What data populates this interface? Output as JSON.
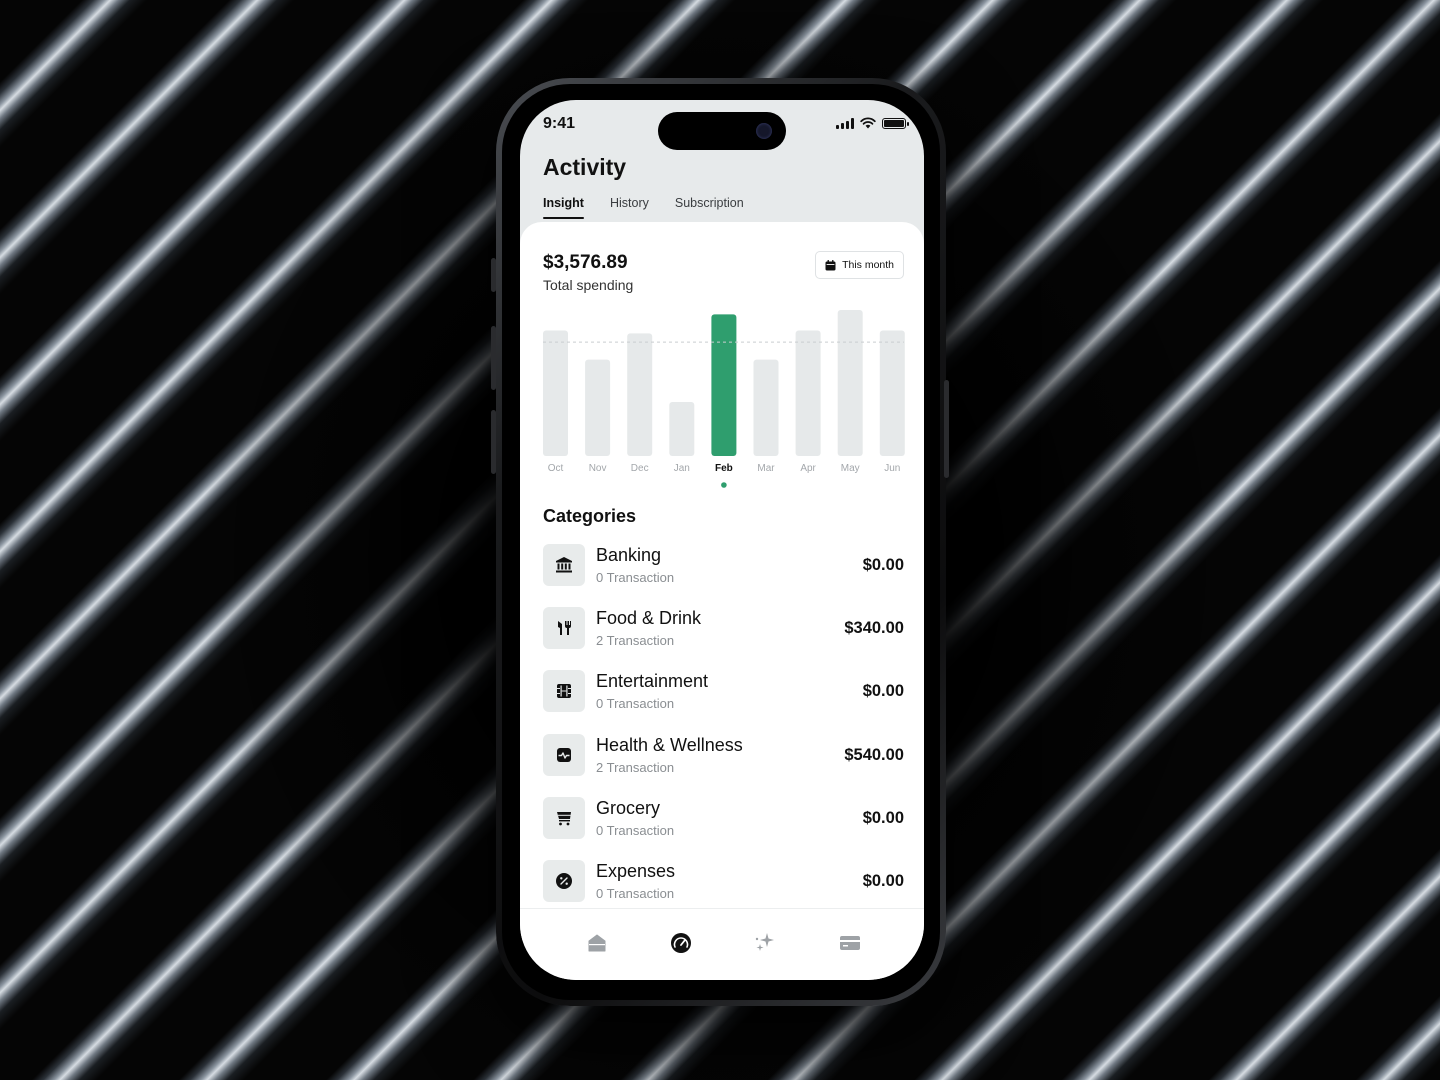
{
  "status": {
    "time": "9:41"
  },
  "header": {
    "title": "Activity",
    "tabs": [
      {
        "label": "Insight",
        "active": true
      },
      {
        "label": "History",
        "active": false
      },
      {
        "label": "Subscription",
        "active": false
      }
    ]
  },
  "summary": {
    "amount": "$3,576.89",
    "label": "Total spending",
    "period_button": "This month"
  },
  "chart_data": {
    "type": "bar",
    "categories": [
      "Oct",
      "Nov",
      "Dec",
      "Jan",
      "Feb",
      "Mar",
      "Apr",
      "May",
      "Jun"
    ],
    "values": [
      0.86,
      0.66,
      0.84,
      0.37,
      0.97,
      0.66,
      0.86,
      1.0,
      0.86
    ],
    "selected": "Feb",
    "colors": {
      "bar": "#e6e9ea",
      "selected": "#2f9e6e",
      "label": "#a3a7ab",
      "selected_label": "#111111"
    },
    "reference_line": 0.78
  },
  "categories": {
    "title": "Categories",
    "items": [
      {
        "name": "Banking",
        "count": "0 Transaction",
        "amount": "$0.00",
        "icon": "bank-icon"
      },
      {
        "name": "Food & Drink",
        "count": "2 Transaction",
        "amount": "$340.00",
        "icon": "fork-knife-icon"
      },
      {
        "name": "Entertainment",
        "count": "0 Transaction",
        "amount": "$0.00",
        "icon": "film-icon"
      },
      {
        "name": "Health & Wellness",
        "count": "2 Transaction",
        "amount": "$540.00",
        "icon": "pulse-icon"
      },
      {
        "name": "Grocery",
        "count": "0 Transaction",
        "amount": "$0.00",
        "icon": "cart-icon"
      },
      {
        "name": "Expenses",
        "count": "0 Transaction",
        "amount": "$0.00",
        "icon": "percent-icon"
      }
    ]
  },
  "nav": {
    "items": [
      {
        "icon": "home-icon",
        "active": false
      },
      {
        "icon": "activity-gauge-icon",
        "active": true
      },
      {
        "icon": "sparkle-icon",
        "active": false
      },
      {
        "icon": "card-icon",
        "active": false
      }
    ]
  }
}
